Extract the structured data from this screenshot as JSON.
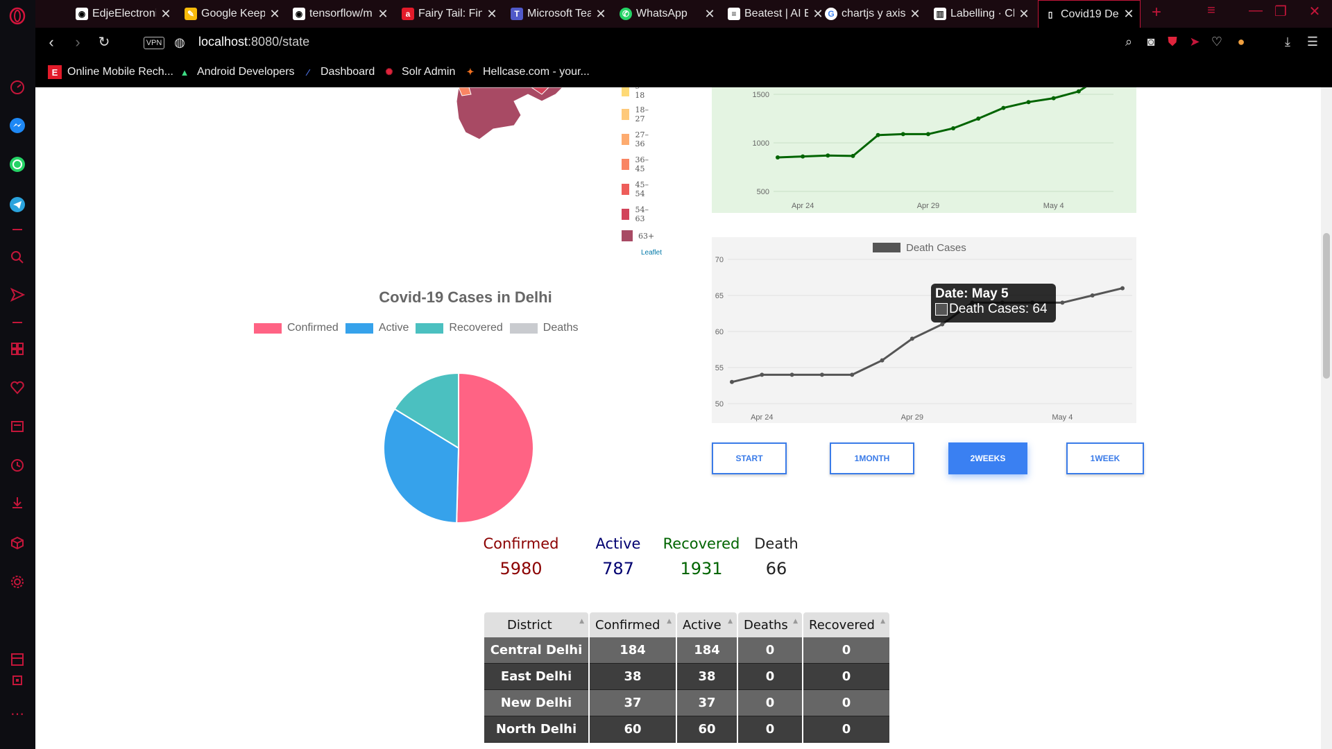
{
  "browser": {
    "tabs": [
      {
        "title": "EdjeElectroni",
        "icon": "github-icon"
      },
      {
        "title": "Google Keep",
        "icon": "keep-icon"
      },
      {
        "title": "tensorflow/m",
        "icon": "github-icon"
      },
      {
        "title": "Fairy Tail: Fin",
        "icon": "anime-icon"
      },
      {
        "title": "Microsoft Tea",
        "icon": "teams-icon"
      },
      {
        "title": "WhatsApp",
        "icon": "whatsapp-icon"
      },
      {
        "title": "Beatest | AI E",
        "icon": "beatest-icon"
      },
      {
        "title": "chartjs y axis",
        "icon": "google-icon"
      },
      {
        "title": "Labelling · Ch",
        "icon": "book-icon"
      },
      {
        "title": "Covid19 Delh",
        "icon": "page-icon"
      }
    ],
    "address": {
      "host": "localhost",
      "path": ":8080/state",
      "vpn_label": "VPN"
    },
    "bookmarks": [
      {
        "label": "Online Mobile Rech...",
        "icon": "e-icon"
      },
      {
        "label": "Android Developers",
        "icon": "android-icon"
      },
      {
        "label": "Dashboard",
        "icon": "dashboard-icon"
      },
      {
        "label": "Solr Admin",
        "icon": "solr-icon"
      },
      {
        "label": "Hellcase.com - your...",
        "icon": "hellcase-icon"
      }
    ]
  },
  "map_legend": {
    "items": [
      {
        "label": "9–18",
        "color": "#fed976"
      },
      {
        "label": "18–27",
        "color": "#fec97a"
      },
      {
        "label": "27–36",
        "color": "#fdab6f"
      },
      {
        "label": "36–45",
        "color": "#f98563"
      },
      {
        "label": "45–54",
        "color": "#ee5d5a"
      },
      {
        "label": "54–63",
        "color": "#d2435a"
      },
      {
        "label": "63+",
        "color": "#a84a64"
      }
    ],
    "attribution": "Leaflet"
  },
  "pie": {
    "title": "Covid-19 Cases in Delhi",
    "legend": [
      {
        "label": "Confirmed",
        "color": "#ff6384"
      },
      {
        "label": "Active",
        "color": "#36a2eb"
      },
      {
        "label": "Recovered",
        "color": "#4bc0c0"
      },
      {
        "label": "Deaths",
        "color": "#c9cbcf"
      }
    ]
  },
  "range_buttons": {
    "start": "START",
    "month": "1MONTH",
    "two_weeks": "2WEEKS",
    "week": "1WEEK",
    "active": "2WEEKS"
  },
  "tooltip": {
    "title": "Date: May 5",
    "body": "Death Cases: 64"
  },
  "stats": {
    "confirmed_label": "Confirmed",
    "confirmed": "5980",
    "active_label": "Active",
    "active": "787",
    "recovered_label": "Recovered",
    "recovered": "1931",
    "death_label": "Death",
    "death": "66"
  },
  "table": {
    "headers": [
      "District",
      "Confirmed",
      "Active",
      "Deaths",
      "Recovered"
    ],
    "rows": [
      [
        "Central Delhi",
        "184",
        "184",
        "0",
        "0"
      ],
      [
        "East Delhi",
        "38",
        "38",
        "0",
        "0"
      ],
      [
        "New Delhi",
        "37",
        "37",
        "0",
        "0"
      ],
      [
        "North Delhi",
        "60",
        "60",
        "0",
        "0"
      ]
    ]
  },
  "chart_data": [
    {
      "type": "pie",
      "categories": [
        "Confirmed",
        "Active",
        "Recovered",
        "Deaths"
      ],
      "values": [
        5980,
        3950,
        1931,
        0
      ],
      "title": "Covid-19 Cases in Delhi",
      "colors": [
        "#ff6384",
        "#36a2eb",
        "#4bc0c0",
        "#c9cbcf"
      ]
    },
    {
      "type": "line",
      "x": [
        "Apr 23",
        "Apr 24",
        "Apr 25",
        "Apr 26",
        "Apr 27",
        "Apr 28",
        "Apr 29",
        "Apr 30",
        "May 1",
        "May 2",
        "May 3",
        "May 4",
        "May 5",
        "May 6"
      ],
      "values": [
        850,
        860,
        870,
        865,
        1080,
        1090,
        1090,
        1150,
        1250,
        1360,
        1420,
        1460,
        1530,
        1700
      ],
      "ylim": [
        500,
        1500
      ],
      "yticks": [
        500,
        1000,
        1500
      ],
      "xticks": [
        "Apr 24",
        "Apr 29",
        "May 4"
      ],
      "color": "#006400"
    },
    {
      "type": "line",
      "series": [
        {
          "name": "Death Cases",
          "values": [
            53,
            54,
            54,
            54,
            54,
            56,
            59,
            61,
            64,
            64,
            64,
            64,
            65,
            66
          ]
        }
      ],
      "x": [
        "Apr 23",
        "Apr 24",
        "Apr 25",
        "Apr 26",
        "Apr 27",
        "Apr 28",
        "Apr 29",
        "Apr 30",
        "May 1",
        "May 2",
        "May 3",
        "May 4",
        "May 5",
        "May 6"
      ],
      "ylim": [
        50,
        70
      ],
      "yticks": [
        50,
        55,
        60,
        65,
        70
      ],
      "xticks": [
        "Apr 24",
        "Apr 29",
        "May 4"
      ],
      "color": "#555555",
      "grid": true
    }
  ]
}
